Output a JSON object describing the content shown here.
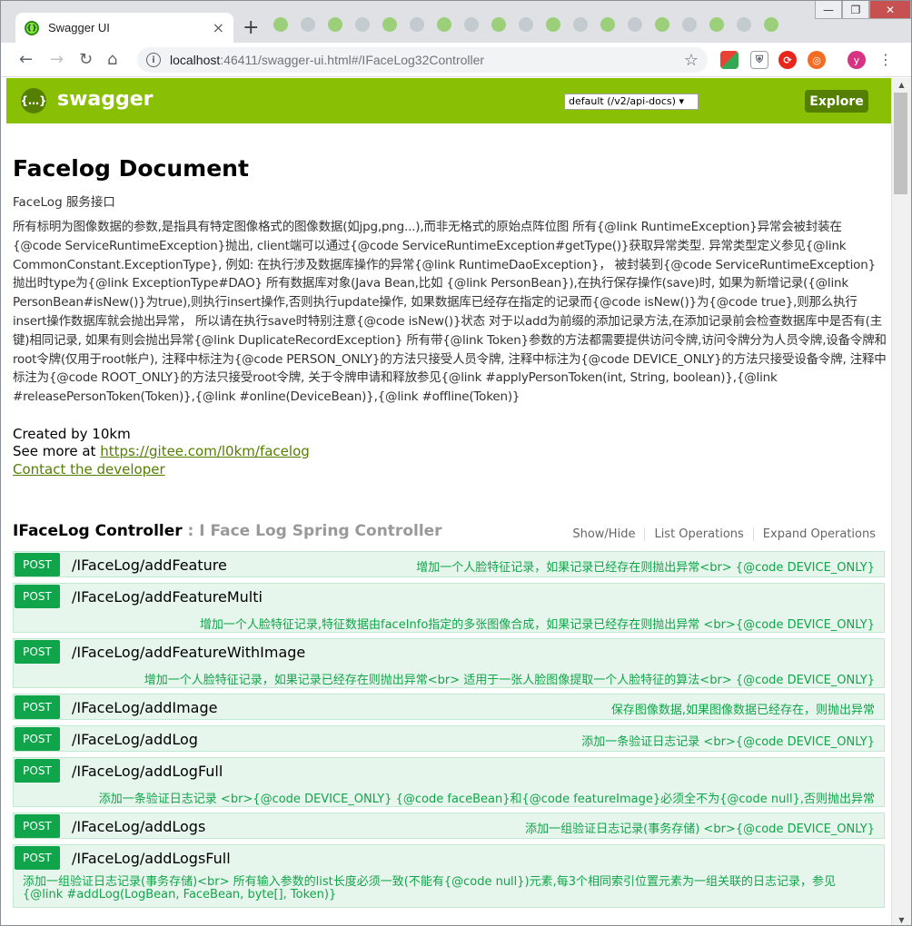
{
  "browser": {
    "tab_title": "Swagger UI",
    "url_host": "localhost",
    "url_rest": ":46411/swagger-ui.html#/IFaceLog32Controller",
    "profile_initial": "y"
  },
  "swagger": {
    "logo_text": "swagger",
    "spec_select": "default (/v2/api-docs)",
    "explore_label": "Explore"
  },
  "info": {
    "title": "Facelog Document",
    "subtitle": "FaceLog 服务接口",
    "description": "所有标明为图像数据的参数,是指具有特定图像格式的图像数据(如jpg,png...),而非无格式的原始点阵位图 所有{@link RuntimeException}异常会被封装在{@code ServiceRuntimeException}抛出, client端可以通过{@code ServiceRuntimeException#getType()}获取异常类型. 异常类型定义参见{@link CommonConstant.ExceptionType}, 例如: 在执行涉及数据库操作的异常{@link RuntimeDaoException}， 被封装到{@code ServiceRuntimeException}抛出时type为{@link ExceptionType#DAO} 所有数据库对象(Java Bean,比如 {@link PersonBean}),在执行保存操作(save)时, 如果为新增记录({@link PersonBean#isNew()}为true),则执行insert操作,否则执行update操作, 如果数据库已经存在指定的记录而{@code isNew()}为{@code true},则那么执行insert操作数据库就会抛出异常， 所以请在执行save时特别注意{@code isNew()}状态 对于以add为前缀的添加记录方法,在添加记录前会检查数据库中是否有(主键)相同记录, 如果有则会抛出异常{@link DuplicateRecordException} 所有带{@link Token}参数的方法都需要提供访问令牌,访问令牌分为人员令牌,设备令牌和root令牌(仅用于root帐户), 注释中标注为{@code PERSON_ONLY}的方法只接受人员令牌, 注释中标注为{@code DEVICE_ONLY}的方法只接受设备令牌, 注释中标注为{@code ROOT_ONLY}的方法只接受root令牌, 关于令牌申请和释放参见{@link #applyPersonToken(int, String, boolean)},{@link #releasePersonToken(Token)},{@link #online(DeviceBean)},{@link #offline(Token)}",
    "created_by": "Created by 10km",
    "see_more": "See more at",
    "see_more_link": "https://gitee.com/l0km/facelog",
    "contact": "Contact the developer"
  },
  "controller": {
    "name": "IFaceLog Controller",
    "desc": " : I Face Log Spring Controller",
    "links": [
      "Show/Hide",
      "List Operations",
      "Expand Operations"
    ]
  },
  "operations": [
    {
      "method": "POST",
      "path": "/IFaceLog/addFeature",
      "summary": "增加一个人脸特征记录，如果记录已经存在则抛出异常<br> {@code DEVICE_ONLY}"
    },
    {
      "method": "POST",
      "path": "/IFaceLog/addFeatureMulti",
      "summary": "增加一个人脸特征记录,特征数据由faceInfo指定的多张图像合成，如果记录已经存在则抛出异常 <br>{@code DEVICE_ONLY}"
    },
    {
      "method": "POST",
      "path": "/IFaceLog/addFeatureWithImage",
      "summary": "增加一个人脸特征记录，如果记录已经存在则抛出异常<br> 适用于一张人脸图像提取一个人脸特征的算法<br> {@code DEVICE_ONLY}"
    },
    {
      "method": "POST",
      "path": "/IFaceLog/addImage",
      "summary": "保存图像数据,如果图像数据已经存在，则抛出异常"
    },
    {
      "method": "POST",
      "path": "/IFaceLog/addLog",
      "summary": "添加一条验证日志记录 <br>{@code DEVICE_ONLY}"
    },
    {
      "method": "POST",
      "path": "/IFaceLog/addLogFull",
      "summary": "添加一条验证日志记录 <br>{@code DEVICE_ONLY} {@code faceBean}和{@code featureImage}必须全不为{@code null},否则抛出异常"
    },
    {
      "method": "POST",
      "path": "/IFaceLog/addLogs",
      "summary": "添加一组验证日志记录(事务存储) <br>{@code DEVICE_ONLY}"
    },
    {
      "method": "POST",
      "path": "/IFaceLog/addLogsFull",
      "summary": "添加一组验证日志记录(事务存储)<br> 所有输入参数的list长度必须一致(不能有{@code null})元素,每3个相同索引位置元素为一组关联的日志记录，参见{@link #addLog(LogBean, FaceBean, byte[], Token)}"
    }
  ]
}
